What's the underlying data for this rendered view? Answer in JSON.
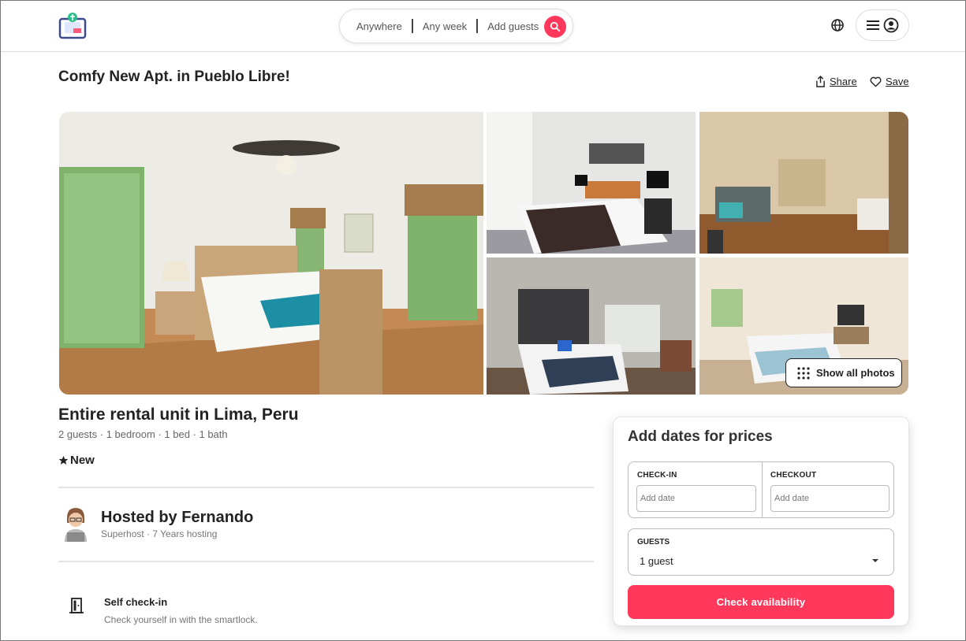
{
  "header": {
    "logo_icon": "suitcase-logo-icon",
    "search": {
      "where": "Anywhere",
      "when": "Any week",
      "who": "Add guests",
      "search_icon": "search-icon"
    },
    "globe_icon": "globe-icon",
    "menu_icon": "hamburger-menu-icon",
    "profile_icon": "user-circle-icon"
  },
  "listing": {
    "title": "Comfy New Apt. in Pueblo Libre!",
    "share_label": "Share",
    "save_label": "Save",
    "show_all_photos_label": "Show all photos",
    "type": "Entire rental unit in Lima, Peru",
    "meta": "2 guests · 1 bedroom · 1 bed · 1 bath",
    "rating": "New"
  },
  "host": {
    "name": "Hosted by Fernando",
    "subtitle": "Superhost · 7 Years hosting"
  },
  "features": [
    {
      "title": "Self check-in",
      "subtitle": "Check yourself in with the smartlock.",
      "icon": "door-icon"
    }
  ],
  "booking": {
    "title": "Add dates for prices",
    "checkin_label": "CHECK-IN",
    "checkout_label": "CHECKOUT",
    "date_placeholder": "Add date",
    "guests_label": "GUESTS",
    "guests_value": "1 guest",
    "button_label": "Check availability"
  },
  "colors": {
    "accent": "#ff385c",
    "text": "#222222",
    "muted": "#666666"
  }
}
